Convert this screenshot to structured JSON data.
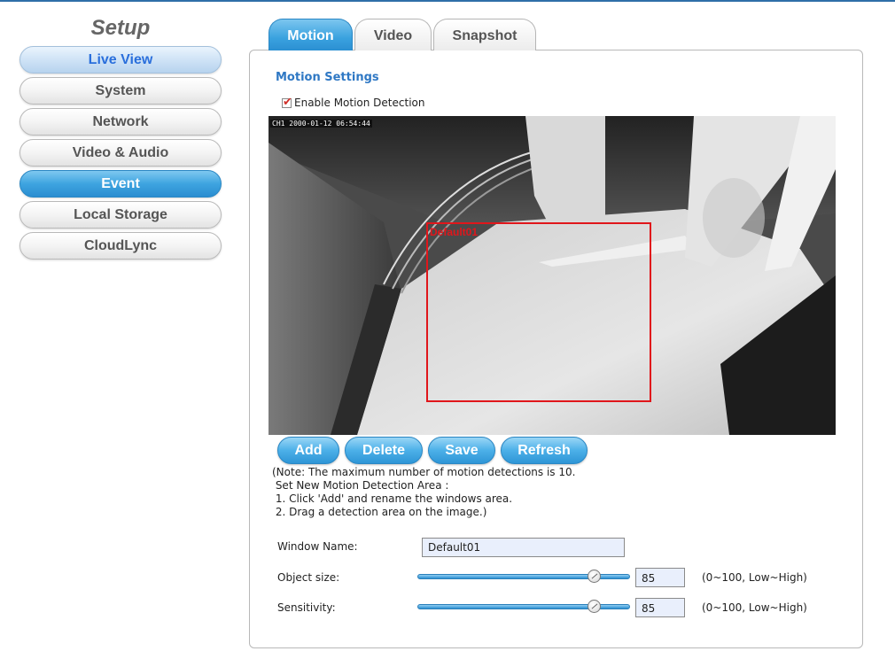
{
  "sidebar": {
    "title": "Setup",
    "items": [
      {
        "label": "Live View",
        "state": "soft"
      },
      {
        "label": "System",
        "state": ""
      },
      {
        "label": "Network",
        "state": ""
      },
      {
        "label": "Video & Audio",
        "state": ""
      },
      {
        "label": "Event",
        "state": "active"
      },
      {
        "label": "Local Storage",
        "state": ""
      },
      {
        "label": "CloudLync",
        "state": ""
      }
    ]
  },
  "tabs": [
    {
      "label": "Motion",
      "active": true
    },
    {
      "label": "Video",
      "active": false
    },
    {
      "label": "Snapshot",
      "active": false
    }
  ],
  "motion": {
    "section_title": "Motion Settings",
    "enable_label": "Enable Motion Detection",
    "enable_checked": true,
    "osd_text": "CH1 2000-01-12 06:54:44",
    "detection_area_label": "Default01",
    "buttons": {
      "add": "Add",
      "delete": "Delete",
      "save": "Save",
      "refresh": "Refresh"
    },
    "note_lines": [
      "(Note: The maximum number of motion detections is 10.",
      " Set New Motion Detection Area :",
      " 1. Click 'Add' and rename the windows area.",
      " 2. Drag a detection area on the image.)"
    ],
    "window_name": {
      "label": "Window Name:",
      "value": "Default01"
    },
    "object_size": {
      "label": "Object size:",
      "value": "85",
      "range": "(0~100, Low~High)"
    },
    "sensitivity": {
      "label": "Sensitivity:",
      "value": "85",
      "range": "(0~100, Low~High)"
    }
  },
  "colors": {
    "accent": "#3aa2df",
    "detection_box": "#e0161b",
    "section_title": "#2f78c4"
  }
}
